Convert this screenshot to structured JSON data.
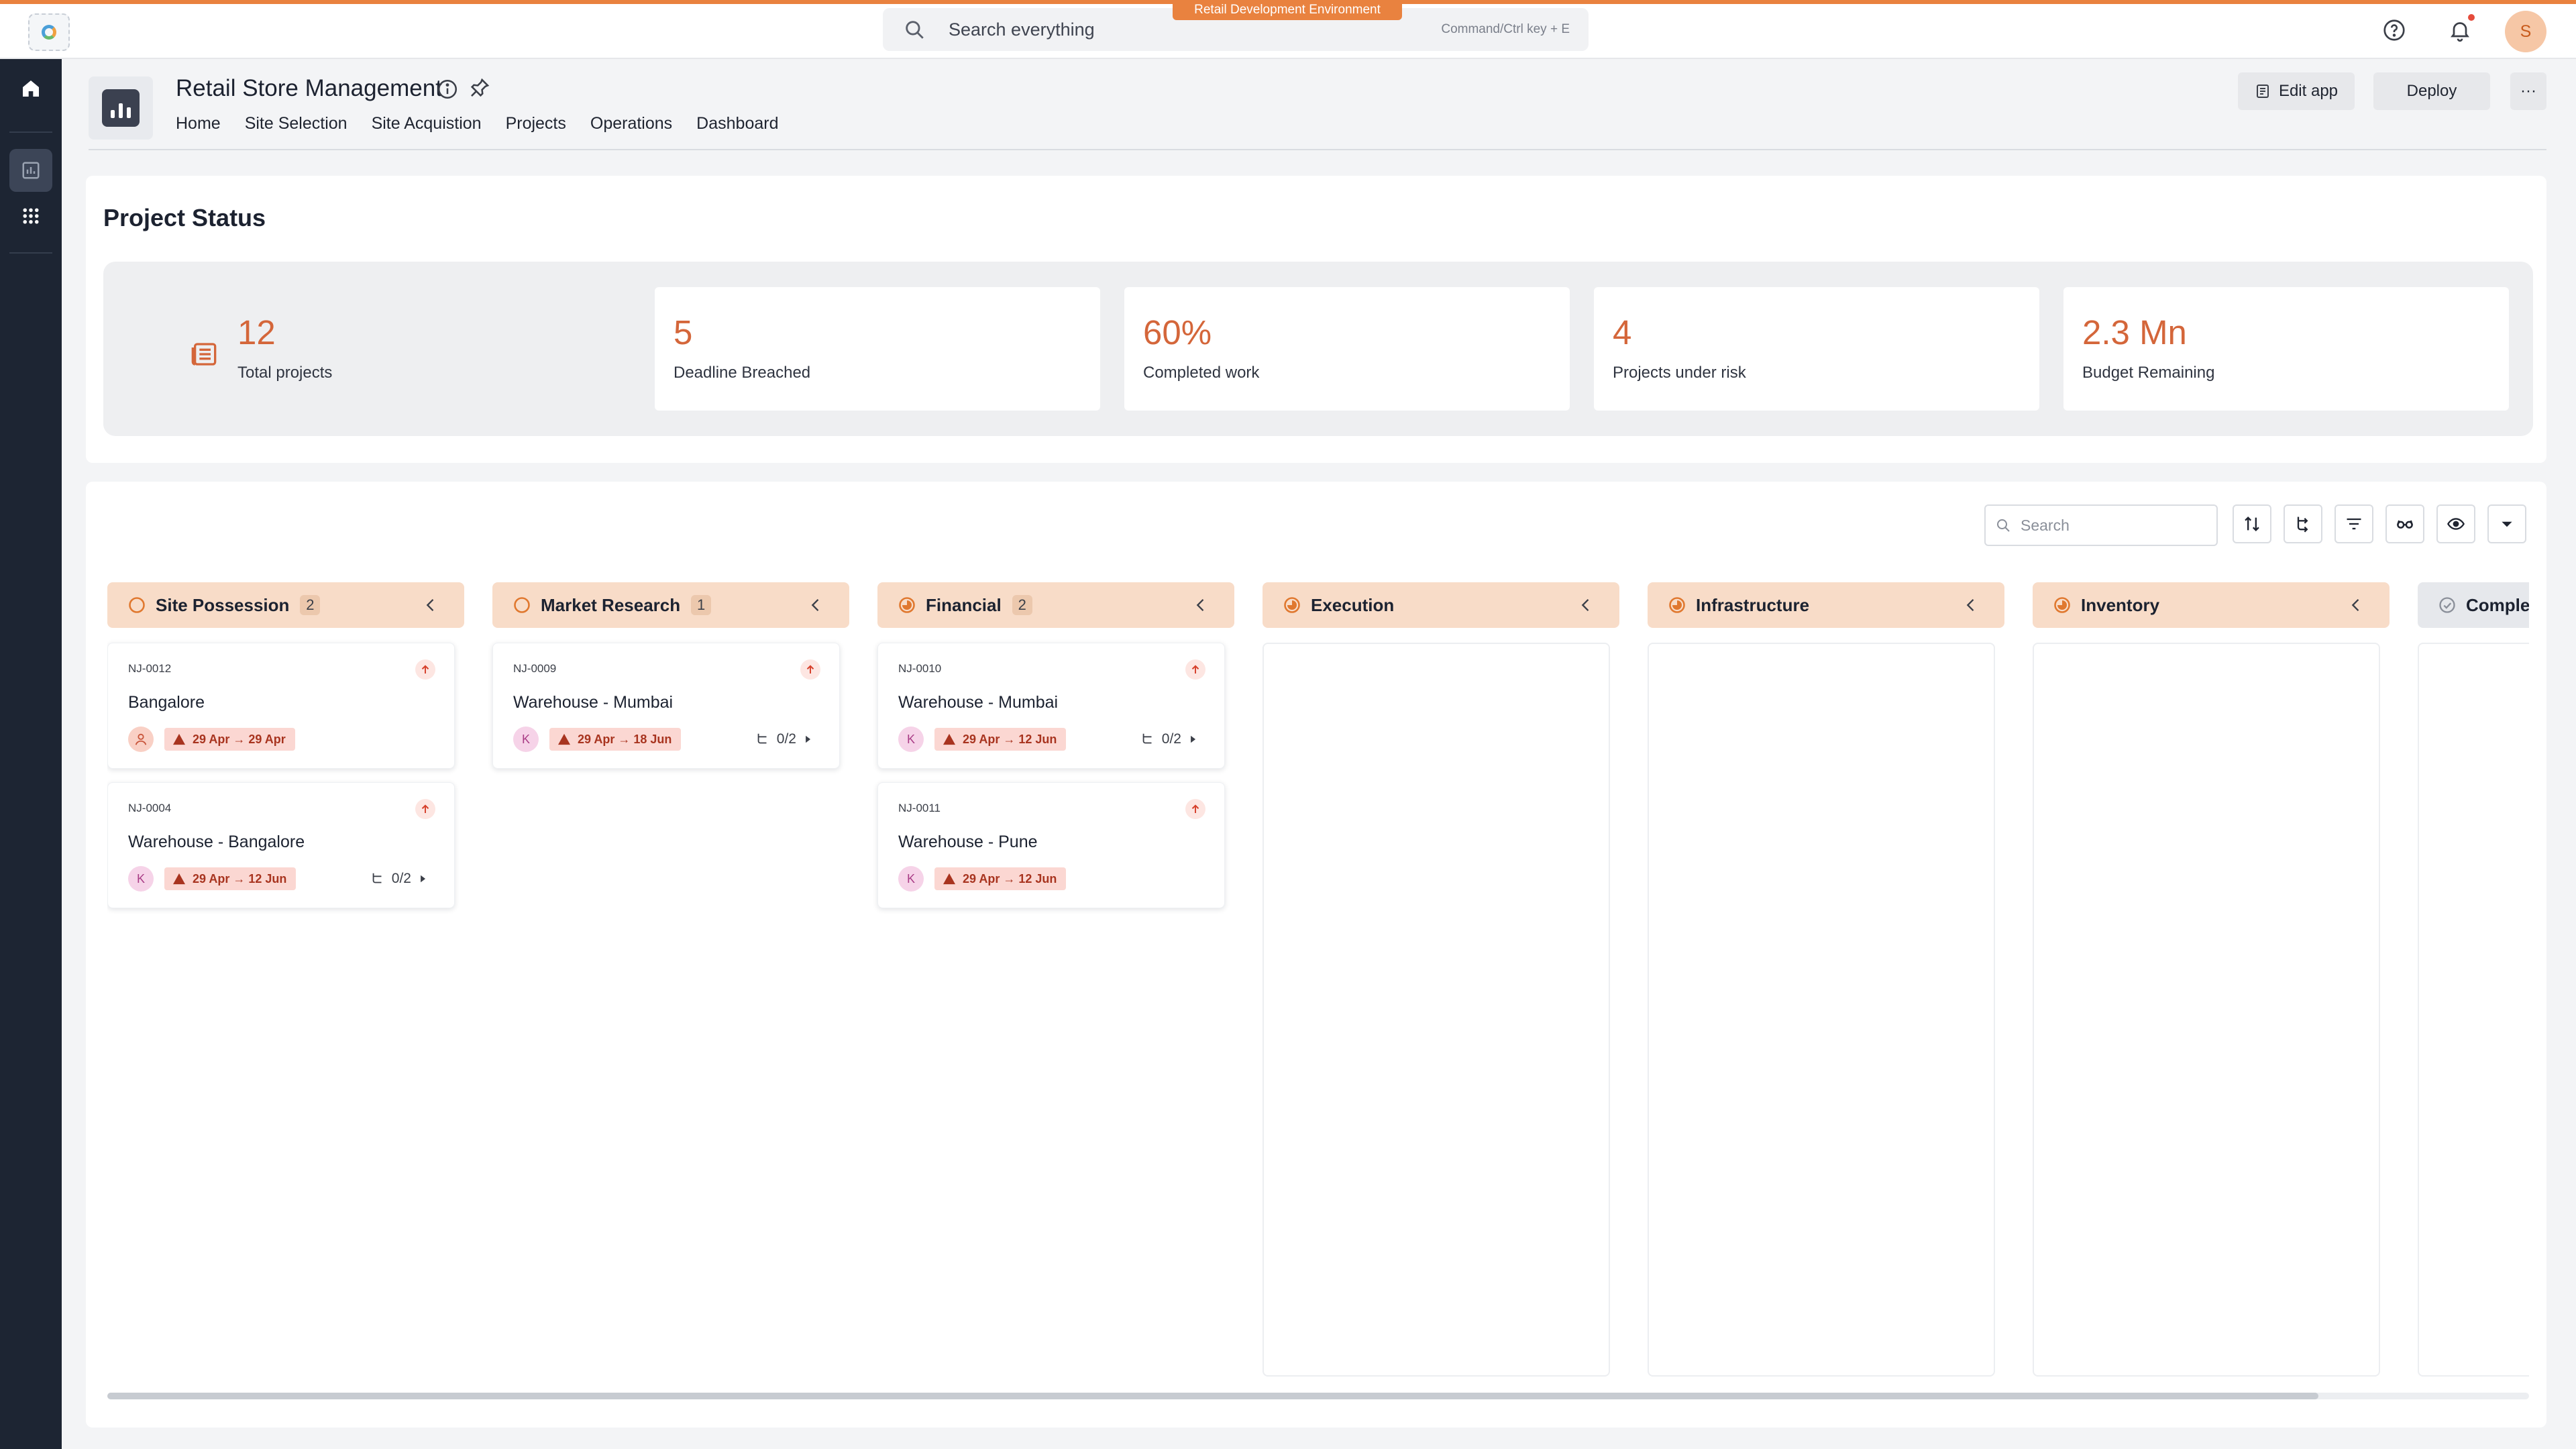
{
  "topbar": {
    "search_placeholder": "Search everything",
    "search_hint": "Command/Ctrl key + E",
    "environment": "Retail Development Environment",
    "user_initial": "S"
  },
  "app": {
    "title": "Retail Store Management",
    "nav": [
      "Home",
      "Site Selection",
      "Site Acquistion",
      "Projects",
      "Operations",
      "Dashboard"
    ],
    "edit_label": "Edit app",
    "deploy_label": "Deploy",
    "more_label": "···"
  },
  "status": {
    "title": "Project Status",
    "stats": [
      {
        "value": "12",
        "label": "Total projects"
      },
      {
        "value": "5",
        "label": "Deadline Breached"
      },
      {
        "value": "60%",
        "label": "Completed work"
      },
      {
        "value": "4",
        "label": "Projects under risk"
      },
      {
        "value": "2.3 Mn",
        "label": "Budget Remaining"
      }
    ]
  },
  "board": {
    "search_placeholder": "Search",
    "columns": [
      {
        "title": "Site Possession",
        "count": "2",
        "status": "open"
      },
      {
        "title": "Market Research",
        "count": "1",
        "status": "open"
      },
      {
        "title": "Financial",
        "count": "2",
        "status": "in-progress"
      },
      {
        "title": "Execution",
        "count": "",
        "status": "in-progress"
      },
      {
        "title": "Infrastructure",
        "count": "",
        "status": "in-progress"
      },
      {
        "title": "Inventory",
        "count": "",
        "status": "in-progress"
      },
      {
        "title": "Complet",
        "count": "",
        "status": "done"
      }
    ],
    "tasks": {
      "c0t0": {
        "id": "NJ-0012",
        "name": "Bangalore",
        "assignee": "",
        "dates": "29 Apr → 29 Apr",
        "subtasks": ""
      },
      "c0t1": {
        "id": "NJ-0004",
        "name": "Warehouse - Bangalore",
        "assignee": "K",
        "dates": "29 Apr → 12 Jun",
        "subtasks": "0/2"
      },
      "c1t0": {
        "id": "NJ-0009",
        "name": "Warehouse - Mumbai",
        "assignee": "K",
        "dates": "29 Apr → 18 Jun",
        "subtasks": "0/2"
      },
      "c2t0": {
        "id": "NJ-0010",
        "name": "Warehouse - Mumbai",
        "assignee": "K",
        "dates": "29 Apr → 12 Jun",
        "subtasks": "0/2"
      },
      "c2t1": {
        "id": "NJ-0011",
        "name": "Warehouse - Pune",
        "assignee": "K",
        "dates": "29 Apr → 12 Jun",
        "subtasks": ""
      }
    }
  },
  "colors": {
    "accent": "#e9823f",
    "stat_number": "#d4663a",
    "column_header": "#f8dcc8",
    "sidebar": "#1d2533",
    "date_badge": "#fbd7d2"
  }
}
